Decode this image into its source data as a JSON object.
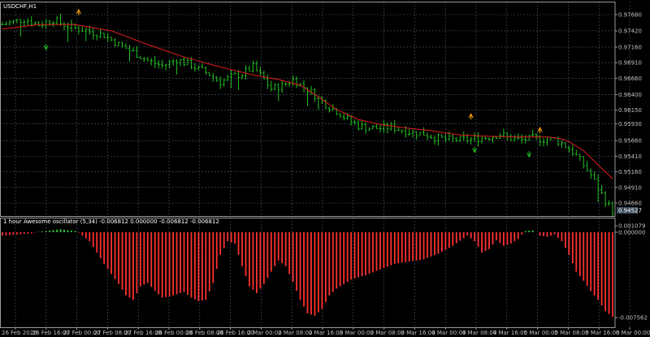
{
  "window": {
    "symbol_title": "USDCHF,H1",
    "indicator_title": "1 hour Awesome oscillator (5,34) -0.006812 0.000000 -0.006812 -0.006812",
    "current_price": "0.94527"
  },
  "colors": {
    "background": "#000000",
    "grid": "#4a5a6a",
    "border": "#9a9a9a",
    "candle": "#22c022",
    "ma": "#e01c1c",
    "osc_neg": "#ff3030",
    "osc_pos": "#32cd32",
    "arrow": "#ffa500",
    "price_tag": "#3a4a5a"
  },
  "chart_data": [
    {
      "type": "candlestick",
      "title": "USDCHF,H1",
      "y_ticks": [
        "0.97680",
        "0.97420",
        "0.97160",
        "0.96910",
        "0.96660",
        "0.96400",
        "0.96150",
        "0.95930",
        "0.95660",
        "0.95410",
        "0.95160",
        "0.94910",
        "0.94660"
      ],
      "ylim": [
        0.9452,
        0.9777
      ],
      "x_ticks": [
        "26 Feb 2020",
        "26 Feb 16:00",
        "27 Feb 00:00",
        "27 Feb 08:00",
        "27 Feb 16:00",
        "28 Feb 00:00",
        "28 Feb 08:00",
        "28 Feb 16:00",
        "2 Mar 00:00",
        "2 Mar 08:00",
        "2 Mar 16:00",
        "3 Mar 00:00",
        "3 Mar 08:00",
        "3 Mar 16:00",
        "4 Mar 00:00",
        "4 Mar 08:00",
        "4 Mar 16:00",
        "5 Mar 00:00",
        "5 Mar 08:00",
        "5 Mar 16:00",
        "6 Mar 00:00"
      ],
      "close_path": [
        [
          0,
          0.9752
        ],
        [
          6,
          0.9761
        ],
        [
          10,
          0.9752
        ],
        [
          14,
          0.976
        ],
        [
          18,
          0.9749
        ],
        [
          22,
          0.9744
        ],
        [
          28,
          0.9735
        ],
        [
          32,
          0.972
        ],
        [
          36,
          0.9708
        ],
        [
          40,
          0.9694
        ],
        [
          44,
          0.9686
        ],
        [
          48,
          0.9696
        ],
        [
          51,
          0.9689
        ],
        [
          54,
          0.9681
        ],
        [
          57,
          0.9672
        ],
        [
          60,
          0.966
        ],
        [
          63,
          0.9668
        ],
        [
          66,
          0.9673
        ],
        [
          69,
          0.9684
        ],
        [
          71,
          0.9671
        ],
        [
          74,
          0.9649
        ],
        [
          77,
          0.9654
        ],
        [
          80,
          0.9664
        ],
        [
          83,
          0.9652
        ],
        [
          86,
          0.9639
        ],
        [
          89,
          0.9624
        ],
        [
          92,
          0.9613
        ],
        [
          95,
          0.96
        ],
        [
          98,
          0.959
        ],
        [
          101,
          0.9586
        ],
        [
          104,
          0.9586
        ],
        [
          107,
          0.9588
        ],
        [
          110,
          0.9583
        ],
        [
          113,
          0.9579
        ],
        [
          116,
          0.9577
        ],
        [
          119,
          0.9571
        ],
        [
          122,
          0.9568
        ],
        [
          126,
          0.9567
        ],
        [
          130,
          0.9569
        ],
        [
          134,
          0.9572
        ],
        [
          137,
          0.9576
        ],
        [
          140,
          0.9569
        ],
        [
          143,
          0.9567
        ],
        [
          146,
          0.957
        ],
        [
          149,
          0.9568
        ],
        [
          152,
          0.9568
        ],
        [
          154,
          0.9562
        ],
        [
          156,
          0.9553
        ],
        [
          158,
          0.9542
        ],
        [
          160,
          0.9527
        ],
        [
          162,
          0.9511
        ],
        [
          164,
          0.949
        ],
        [
          166,
          0.947
        ],
        [
          168,
          0.9453
        ]
      ],
      "ma_path": [
        [
          0,
          0.9745
        ],
        [
          10,
          0.9752
        ],
        [
          20,
          0.9752
        ],
        [
          30,
          0.9742
        ],
        [
          40,
          0.972
        ],
        [
          50,
          0.97
        ],
        [
          60,
          0.9684
        ],
        [
          70,
          0.967
        ],
        [
          76,
          0.9664
        ],
        [
          82,
          0.9655
        ],
        [
          86,
          0.964
        ],
        [
          92,
          0.9616
        ],
        [
          98,
          0.96
        ],
        [
          104,
          0.9592
        ],
        [
          110,
          0.9587
        ],
        [
          118,
          0.9582
        ],
        [
          126,
          0.9575
        ],
        [
          134,
          0.9573
        ],
        [
          142,
          0.9572
        ],
        [
          150,
          0.9572
        ],
        [
          155,
          0.9568
        ],
        [
          160,
          0.955
        ],
        [
          164,
          0.9527
        ],
        [
          168,
          0.9505
        ]
      ],
      "fractals_up": [
        [
          21,
          0.9772
        ],
        [
          129,
          0.9605
        ],
        [
          148,
          0.9583
        ]
      ],
      "fractals_down": [
        [
          12,
          0.9716
        ],
        [
          130,
          0.9551
        ],
        [
          145,
          0.9544
        ]
      ]
    },
    {
      "type": "bar",
      "title": "1 hour Awesome oscillator (5,34)",
      "y_ticks": [
        "0.001079",
        "0.000000",
        "-0.007562"
      ],
      "ylim": [
        -0.007562,
        0.001079
      ],
      "envelope": [
        [
          0,
          -0.0003
        ],
        [
          8,
          -0.0001
        ],
        [
          12,
          0.0002
        ],
        [
          16,
          0.0005
        ],
        [
          20,
          0.0002
        ],
        [
          24,
          -0.0008
        ],
        [
          28,
          -0.0028
        ],
        [
          32,
          -0.0046
        ],
        [
          34,
          -0.0056
        ],
        [
          36,
          -0.006
        ],
        [
          38,
          -0.0048
        ],
        [
          40,
          -0.0045
        ],
        [
          42,
          -0.0052
        ],
        [
          44,
          -0.0058
        ],
        [
          46,
          -0.0057
        ],
        [
          48,
          -0.0055
        ],
        [
          50,
          -0.0053
        ],
        [
          52,
          -0.0058
        ],
        [
          54,
          -0.0061
        ],
        [
          56,
          -0.006
        ],
        [
          58,
          -0.0045
        ],
        [
          60,
          -0.002
        ],
        [
          62,
          -0.0008
        ],
        [
          64,
          -0.001
        ],
        [
          66,
          -0.003
        ],
        [
          68,
          -0.0048
        ],
        [
          70,
          -0.0054
        ],
        [
          72,
          -0.0046
        ],
        [
          74,
          -0.0035
        ],
        [
          76,
          -0.0025
        ],
        [
          78,
          -0.003
        ],
        [
          80,
          -0.0044
        ],
        [
          82,
          -0.006
        ],
        [
          84,
          -0.0072
        ],
        [
          86,
          -0.0074
        ],
        [
          88,
          -0.0068
        ],
        [
          90,
          -0.0056
        ],
        [
          92,
          -0.005
        ],
        [
          94,
          -0.0046
        ],
        [
          96,
          -0.0042
        ],
        [
          100,
          -0.0038
        ],
        [
          104,
          -0.0033
        ],
        [
          108,
          -0.0028
        ],
        [
          112,
          -0.0026
        ],
        [
          116,
          -0.0024
        ],
        [
          120,
          -0.0019
        ],
        [
          124,
          -0.0012
        ],
        [
          128,
          -0.0003
        ],
        [
          130,
          -0.0008
        ],
        [
          132,
          -0.0018
        ],
        [
          134,
          -0.0015
        ],
        [
          136,
          -0.0007
        ],
        [
          138,
          -0.0012
        ],
        [
          140,
          -0.001
        ],
        [
          142,
          -0.0006
        ],
        [
          144,
          0.0002
        ],
        [
          146,
          0.0003
        ],
        [
          148,
          -0.0003
        ],
        [
          150,
          -0.0004
        ],
        [
          152,
          -0.0002
        ],
        [
          154,
          -0.0008
        ],
        [
          156,
          -0.002
        ],
        [
          158,
          -0.0035
        ],
        [
          160,
          -0.0043
        ],
        [
          162,
          -0.0052
        ],
        [
          164,
          -0.006
        ],
        [
          166,
          -0.007
        ],
        [
          168,
          -0.0075
        ]
      ]
    }
  ]
}
